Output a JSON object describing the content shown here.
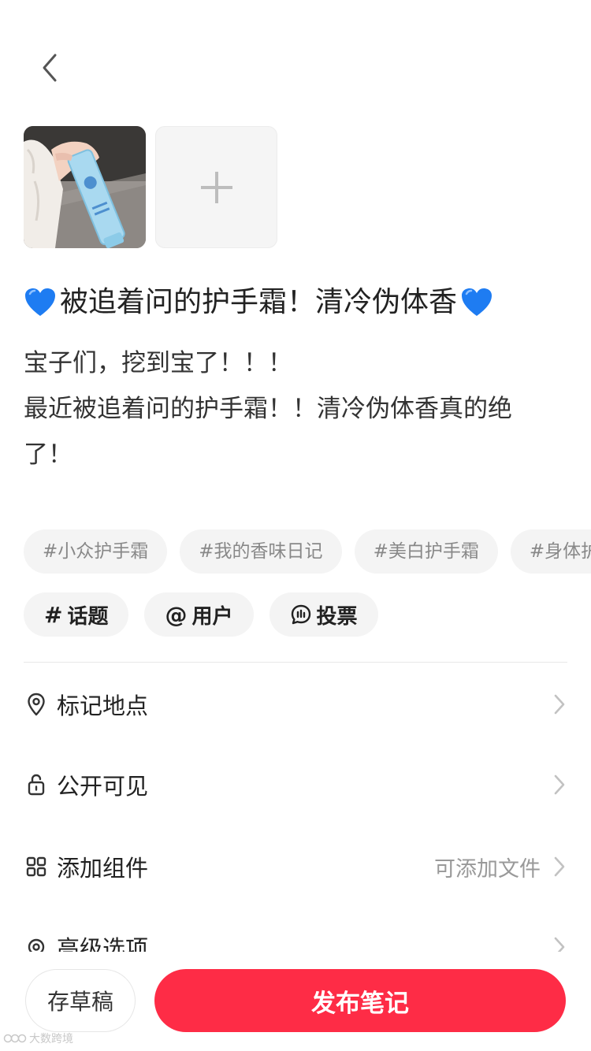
{
  "header": {
    "back_icon": "chevron-left-icon"
  },
  "media": {
    "thumbnail_alt": "hand cream photo",
    "add_icon": "plus-icon"
  },
  "note": {
    "title_text": "被追着问的护手霜！清冷伪体香",
    "title_emoji": "blue-heart",
    "body_lines": [
      "宝子们，挖到宝了！！！",
      "最近被追着问的护手霜！！清冷伪体香真的绝",
      "了！"
    ]
  },
  "tags": [
    "#小众护手霜",
    "#我的香味日记",
    "#美白护手霜",
    "#身体护理"
  ],
  "tools": [
    {
      "symbol": "#",
      "label": "话题"
    },
    {
      "symbol": "@",
      "label": "用户"
    },
    {
      "icon": "poll-icon",
      "label": "投票"
    }
  ],
  "settings": [
    {
      "icon": "location-pin-icon",
      "label": "标记地点",
      "hint": ""
    },
    {
      "icon": "lock-icon",
      "label": "公开可见",
      "hint": ""
    },
    {
      "icon": "grid-icon",
      "label": "添加组件",
      "hint": "可添加文件"
    },
    {
      "icon": "gear-icon",
      "label": "高级选项",
      "hint": ""
    }
  ],
  "footer": {
    "draft_label": "存草稿",
    "publish_label": "发布笔记"
  },
  "watermark": {
    "text": "大数跨境"
  },
  "colors": {
    "accent": "#fe2c46",
    "heart": "#1e7cf2"
  }
}
